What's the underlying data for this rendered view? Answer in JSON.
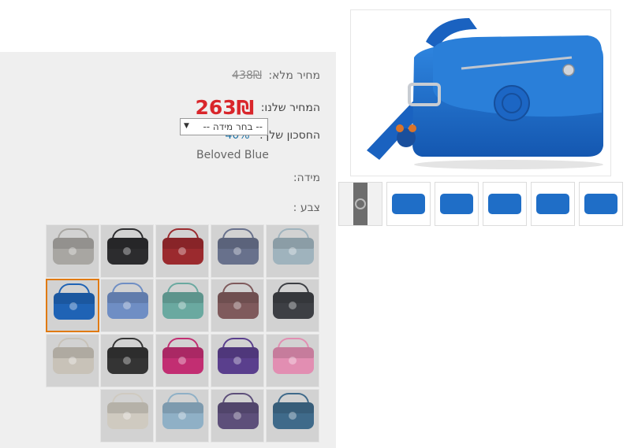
{
  "product": {
    "full_price_label": "מחיר מלא:",
    "full_price": "438₪",
    "our_price_label": "המחיר שלנו:",
    "our_price": "263₪",
    "savings_label": "החסכון שלך:",
    "savings_value": "40%",
    "size_label": "מידה:",
    "size_select_value": "-- בחר מידה --",
    "color_label": "צבע :",
    "color_value": "Beloved Blue"
  },
  "swatches": [
    {
      "name": "silver-grey",
      "color": "#a8a6a2"
    },
    {
      "name": "black",
      "color": "#2c2c2e"
    },
    {
      "name": "red",
      "color": "#9b2a2e"
    },
    {
      "name": "slate-blue",
      "color": "#68718c"
    },
    {
      "name": "light-blue",
      "color": "#9fb3bd"
    },
    {
      "name": "beloved-blue",
      "color": "#1f63b5",
      "selected": true
    },
    {
      "name": "periwinkle",
      "color": "#6f8ec4"
    },
    {
      "name": "mint",
      "color": "#6aa9a0"
    },
    {
      "name": "abstract-print",
      "color": "#7f5a5c"
    },
    {
      "name": "charcoal",
      "color": "#3d3f44"
    },
    {
      "name": "pearl",
      "color": "#c8c2b8"
    },
    {
      "name": "black-2",
      "color": "#343434"
    },
    {
      "name": "magenta",
      "color": "#c22e72"
    },
    {
      "name": "purple",
      "color": "#5a3f8d"
    },
    {
      "name": "pink",
      "color": "#e28eb2"
    },
    {
      "name": "cream",
      "color": "#cfcac0"
    },
    {
      "name": "spotted-print",
      "color": "#8fb0c6"
    },
    {
      "name": "floral-print",
      "color": "#5d4f7a"
    },
    {
      "name": "mosaic-print",
      "color": "#3f6a8a"
    }
  ],
  "gallery": {
    "main_color": "#1f6ec7",
    "thumbnails": [
      "video",
      "open-top",
      "front",
      "side",
      "back",
      "strap-view"
    ]
  }
}
